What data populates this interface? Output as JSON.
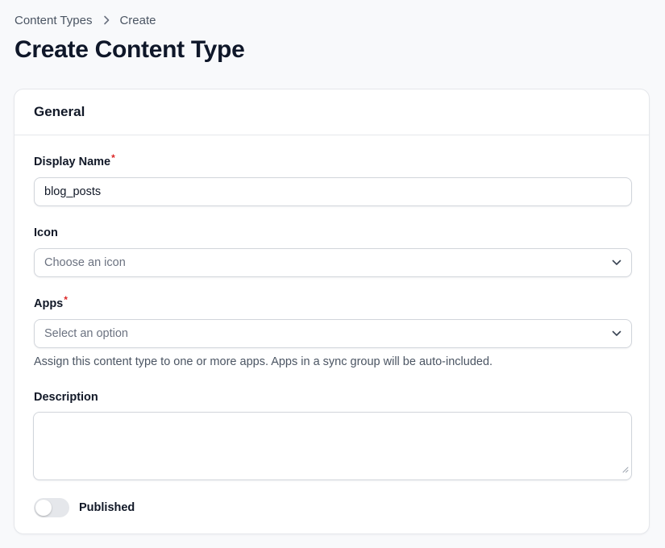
{
  "breadcrumb": {
    "items": [
      "Content Types",
      "Create"
    ],
    "separator_icon": "chevron-right-icon"
  },
  "page": {
    "title": "Create Content Type"
  },
  "section": {
    "title": "General"
  },
  "fields": {
    "display_name": {
      "label": "Display Name",
      "required_mark": "*",
      "value": "blog_posts"
    },
    "icon": {
      "label": "Icon",
      "placeholder": "Choose an icon",
      "dropdown_icon": "chevron-down-icon"
    },
    "apps": {
      "label": "Apps",
      "required_mark": "*",
      "placeholder": "Select an option",
      "dropdown_icon": "chevron-down-icon",
      "help_text": "Assign this content type to one or more apps. Apps in a sync group will be auto-included."
    },
    "description": {
      "label": "Description",
      "value": ""
    },
    "published": {
      "label": "Published",
      "checked": false
    }
  },
  "colors": {
    "background": "#f8f9fb",
    "card": "#ffffff",
    "border": "#e5e7eb",
    "required": "#dc2626",
    "toggle_off": "#e5e7eb"
  }
}
